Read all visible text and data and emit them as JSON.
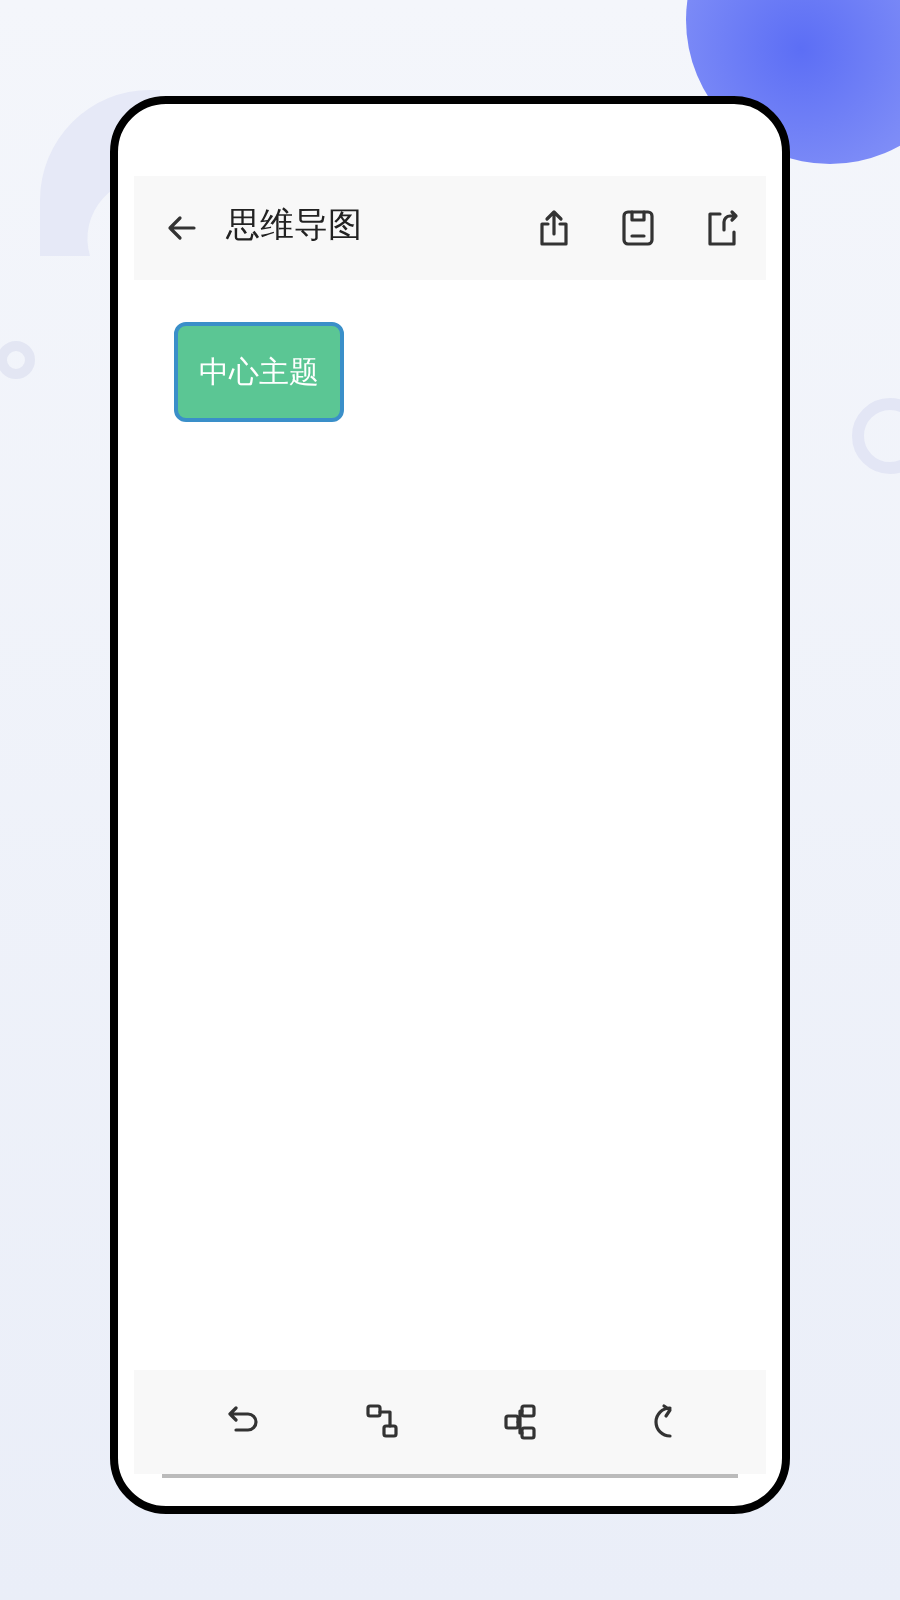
{
  "header": {
    "title": "思维导图"
  },
  "nodes": [
    {
      "text": "中心主题",
      "selected": true
    }
  ]
}
